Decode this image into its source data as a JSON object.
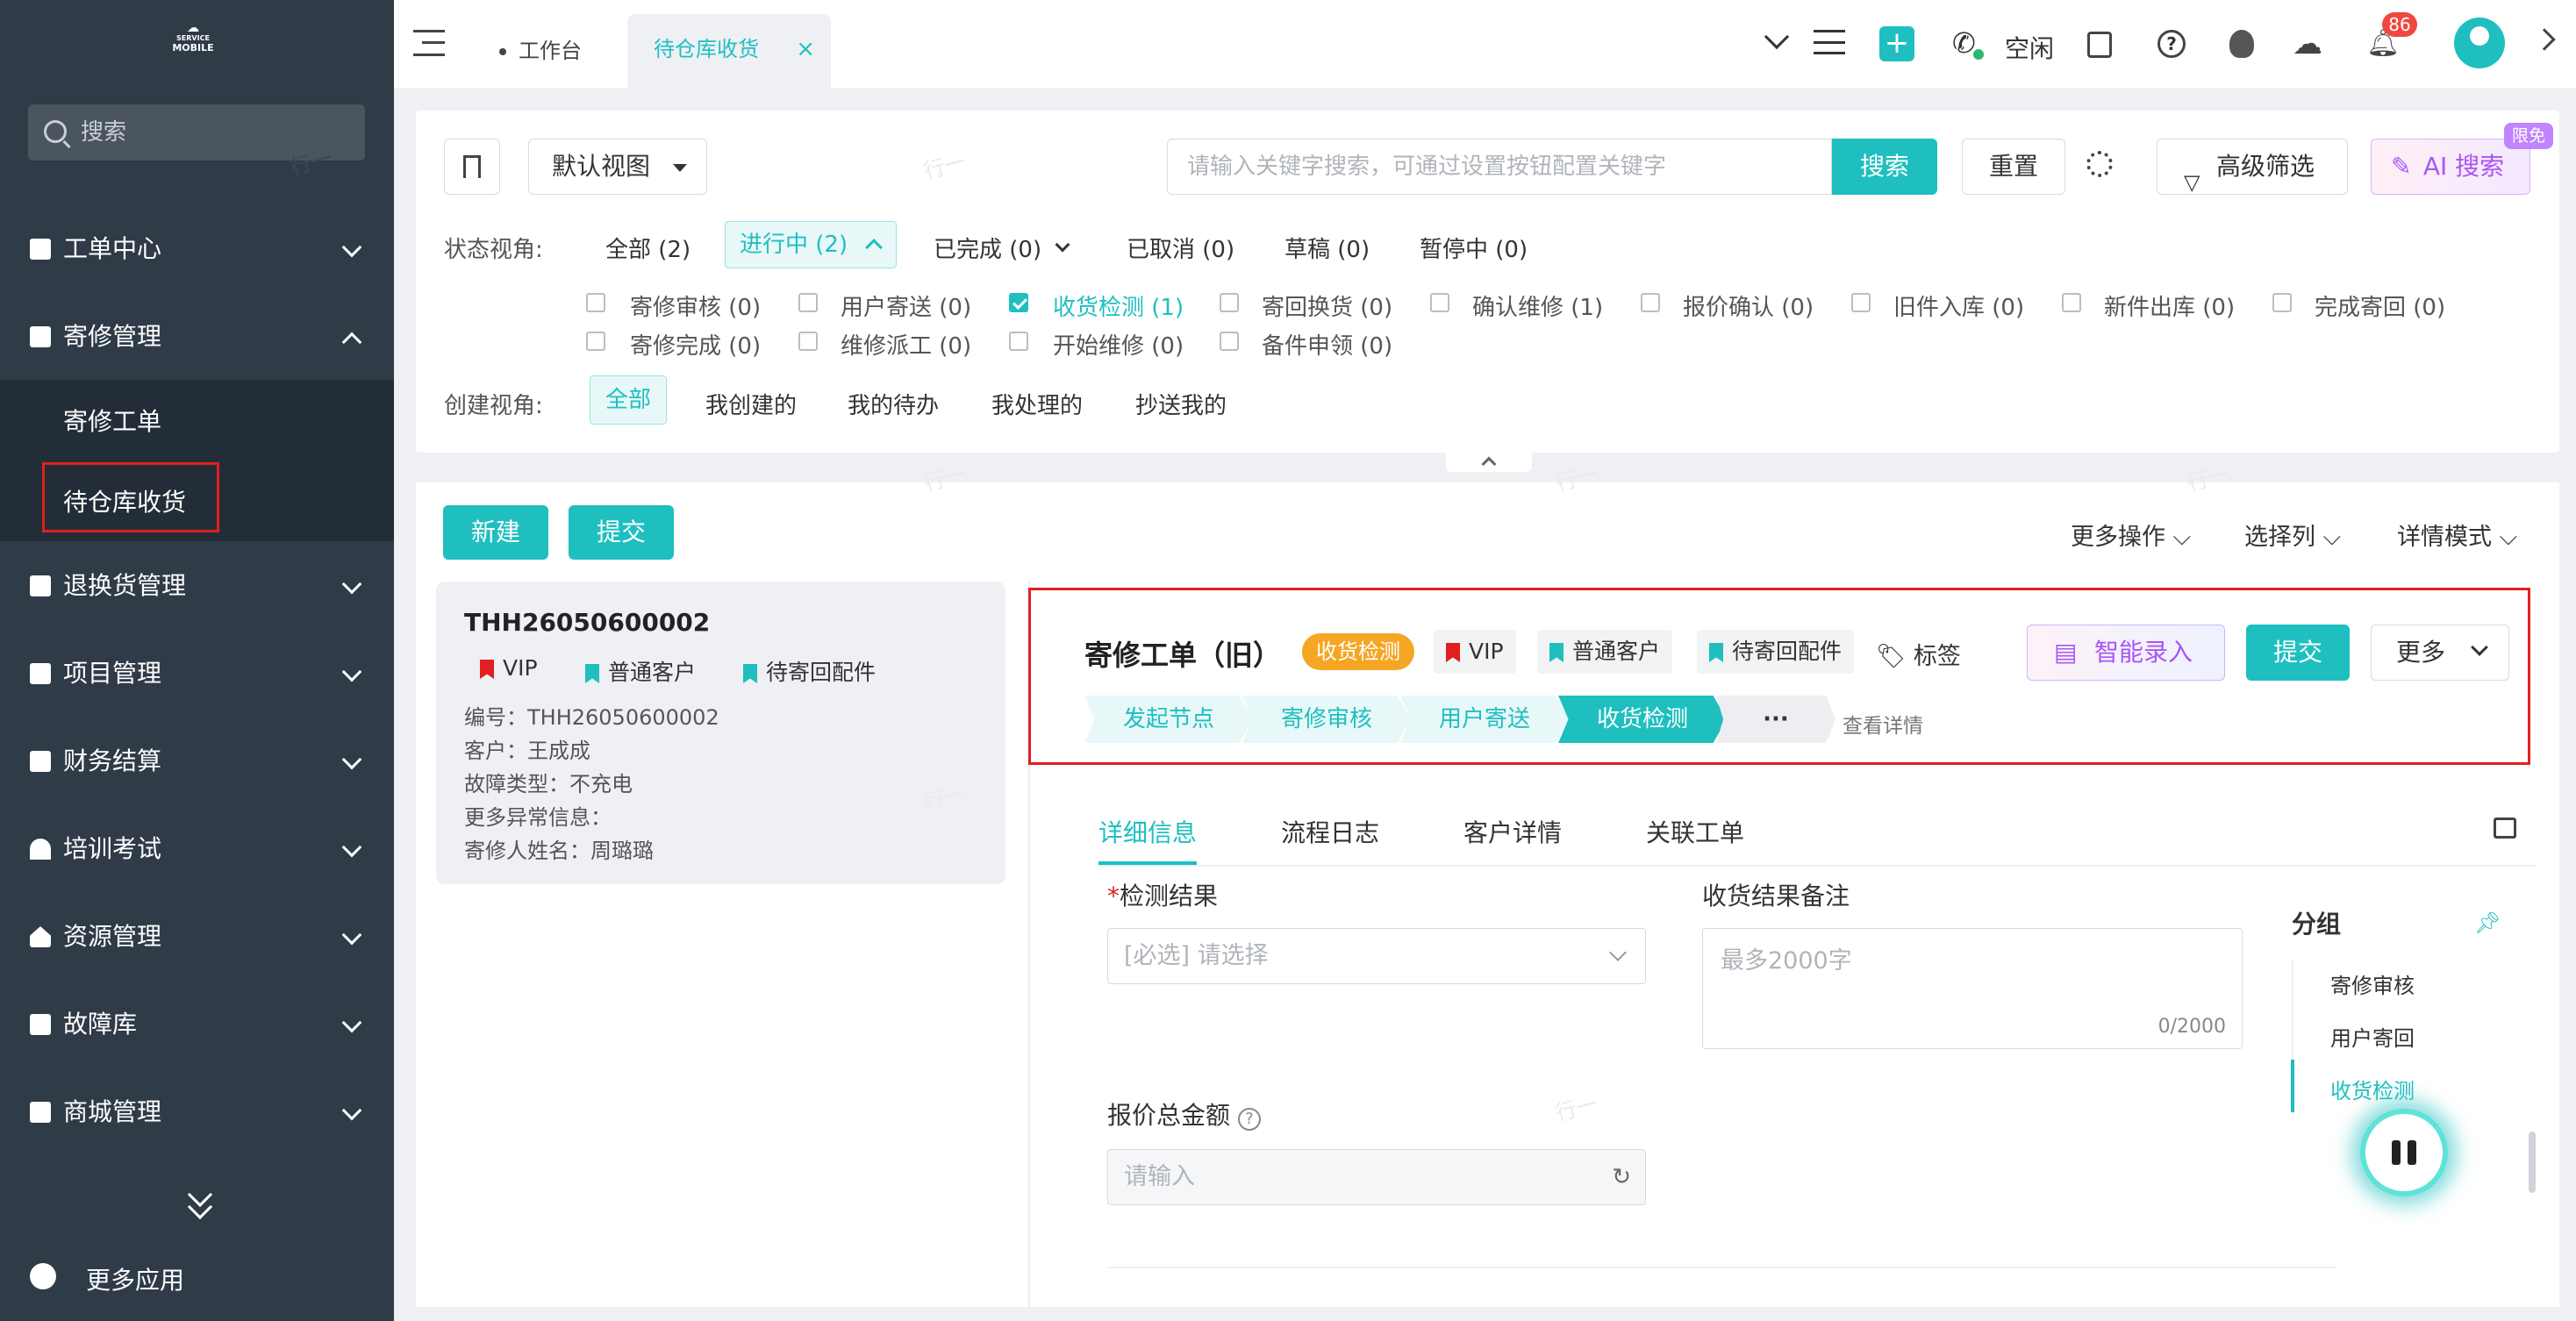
{
  "sidebar": {
    "logo_top": "SERVICE",
    "logo_bottom": "MOBILE",
    "search_placeholder": "搜索",
    "menu": [
      {
        "label": "工单中心"
      },
      {
        "label": "寄修管理"
      },
      {
        "label": "退换货管理"
      },
      {
        "label": "项目管理"
      },
      {
        "label": "财务结算"
      },
      {
        "label": "培训考试"
      },
      {
        "label": "资源管理"
      },
      {
        "label": "故障库"
      },
      {
        "label": "商城管理"
      }
    ],
    "sub_items": [
      "寄修工单",
      "待仓库收货"
    ],
    "more_apps": "更多应用"
  },
  "header": {
    "tab_home": "工作台",
    "tab_active": "待仓库收货",
    "status": "空闲",
    "notif_count": "86"
  },
  "filter": {
    "view": "默认视图",
    "search_placeholder": "请输入关键字搜索，可通过设置按钮配置关键字",
    "search_btn": "搜索",
    "reset_btn": "重置",
    "advanced_btn": "高级筛选",
    "ai_btn": "AI 搜索",
    "ai_badge": "限免",
    "state_label": "状态视角:",
    "states": [
      "全部 (2)",
      "进行中 (2)",
      "已完成 (0)",
      "已取消 (0)",
      "草稿 (0)",
      "暂停中 (0)"
    ],
    "substates_row1": [
      "寄修审核 (0)",
      "用户寄送 (0)",
      "收货检测 (1)",
      "寄回换货 (0)",
      "确认维修 (1)",
      "报价确认 (0)",
      "旧件入库 (0)",
      "新件出库 (0)",
      "完成寄回 (0)"
    ],
    "substates_row2": [
      "寄修完成 (0)",
      "维修派工 (0)",
      "开始维修 (0)",
      "备件申领 (0)"
    ],
    "create_label": "创建视角:",
    "creates": [
      "全部",
      "我创建的",
      "我的待办",
      "我处理的",
      "抄送我的"
    ]
  },
  "toolbar": {
    "new_btn": "新建",
    "submit_btn": "提交",
    "more_ops": "更多操作",
    "select_cols": "选择列",
    "detail_mode": "详情模式"
  },
  "card": {
    "id": "THH26050600002",
    "tags": [
      "VIP",
      "普通客户",
      "待寄回配件"
    ],
    "lines": [
      "编号：THH26050600002",
      "客户：王成成",
      "故障类型：不充电",
      "更多异常信息：",
      "寄修人姓名：周璐璐"
    ]
  },
  "detail": {
    "title": "寄修工单（旧）",
    "status_badge": "收货检测",
    "tags": [
      "VIP",
      "普通客户",
      "待寄回配件"
    ],
    "tag_label": "标签",
    "smart_btn": "智能录入",
    "submit_btn": "提交",
    "more_btn": "更多",
    "steps": [
      "发起节点",
      "寄修审核",
      "用户寄送",
      "收货检测",
      "···"
    ],
    "view_detail": "查看详情",
    "tabs": [
      "详细信息",
      "流程日志",
      "客户详情",
      "关联工单"
    ],
    "field_result_label": "检测结果",
    "field_result_placeholder": "[必选] 请选择",
    "field_note_label": "收货结果备注",
    "field_note_placeholder": "最多2000字",
    "field_note_count": "0/2000",
    "field_price_label": "报价总金额",
    "field_price_placeholder": "请输入",
    "group_title": "分组",
    "groups": [
      "寄修审核",
      "用户寄回",
      "收货检测"
    ]
  },
  "watermark": "行一",
  "colors": {
    "accent": "#1fbfc0",
    "sidebar": "#2f3b47",
    "badge": "#f5a623",
    "flag": "#e02020",
    "highlight_box": "#e02020"
  }
}
